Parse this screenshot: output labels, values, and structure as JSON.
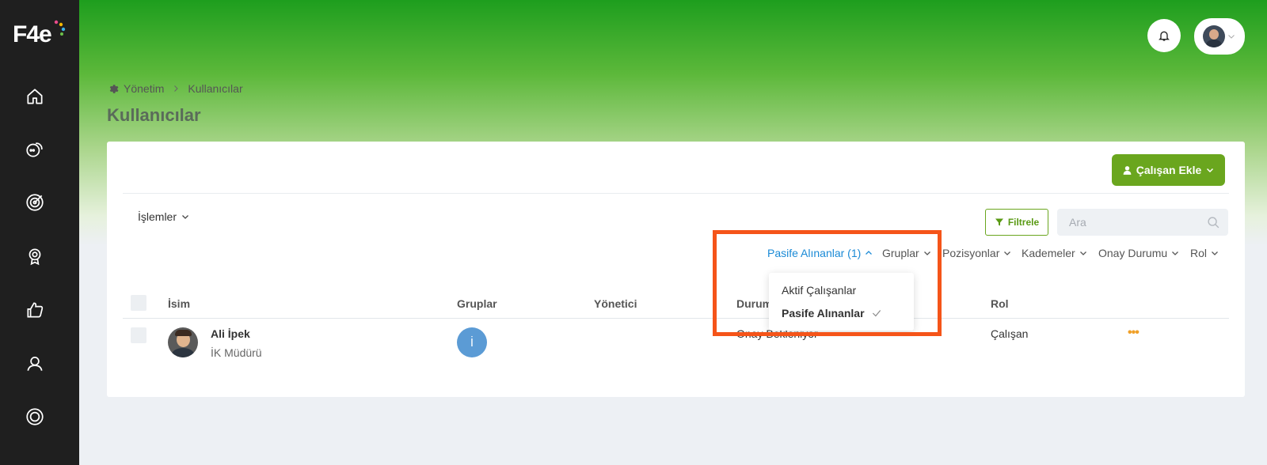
{
  "brand": {
    "logo_text": "F4e"
  },
  "header": {
    "notifications": "bell-icon",
    "profile": "user-avatar"
  },
  "breadcrumb": {
    "root": "Yönetim",
    "current": "Kullanıcılar"
  },
  "page": {
    "title": "Kullanıcılar"
  },
  "toolbar": {
    "add_employee_label": "Çalışan Ekle",
    "operations_label": "İşlemler",
    "filter_label": "Filtrele",
    "search_placeholder": "Ara"
  },
  "filters": [
    {
      "label": "Pasife Alınanlar (1)",
      "active": true
    },
    {
      "label": "Gruplar"
    },
    {
      "label": "Pozisyonlar"
    },
    {
      "label": "Kademeler"
    },
    {
      "label": "Onay Durumu"
    },
    {
      "label": "Rol"
    }
  ],
  "dropdown": {
    "items": [
      {
        "label": "Aktif Çalışanlar",
        "selected": false
      },
      {
        "label": "Pasife Alınanlar",
        "selected": true
      }
    ]
  },
  "table": {
    "columns": [
      "İsim",
      "Gruplar",
      "Yönetici",
      "Durum",
      "Rol"
    ],
    "rows": [
      {
        "name": "Ali İpek",
        "title": "İK Müdürü",
        "group_initial": "İ",
        "status": "Onay Bekleniyor",
        "role": "Çalışan",
        "actions": "•••"
      }
    ]
  },
  "colors": {
    "brand_green": "#6aa61e",
    "active_link": "#1a8ad6",
    "highlight": "#f55419",
    "sidebar": "#1f1f1f",
    "group_badge": "#5b9bd5"
  }
}
